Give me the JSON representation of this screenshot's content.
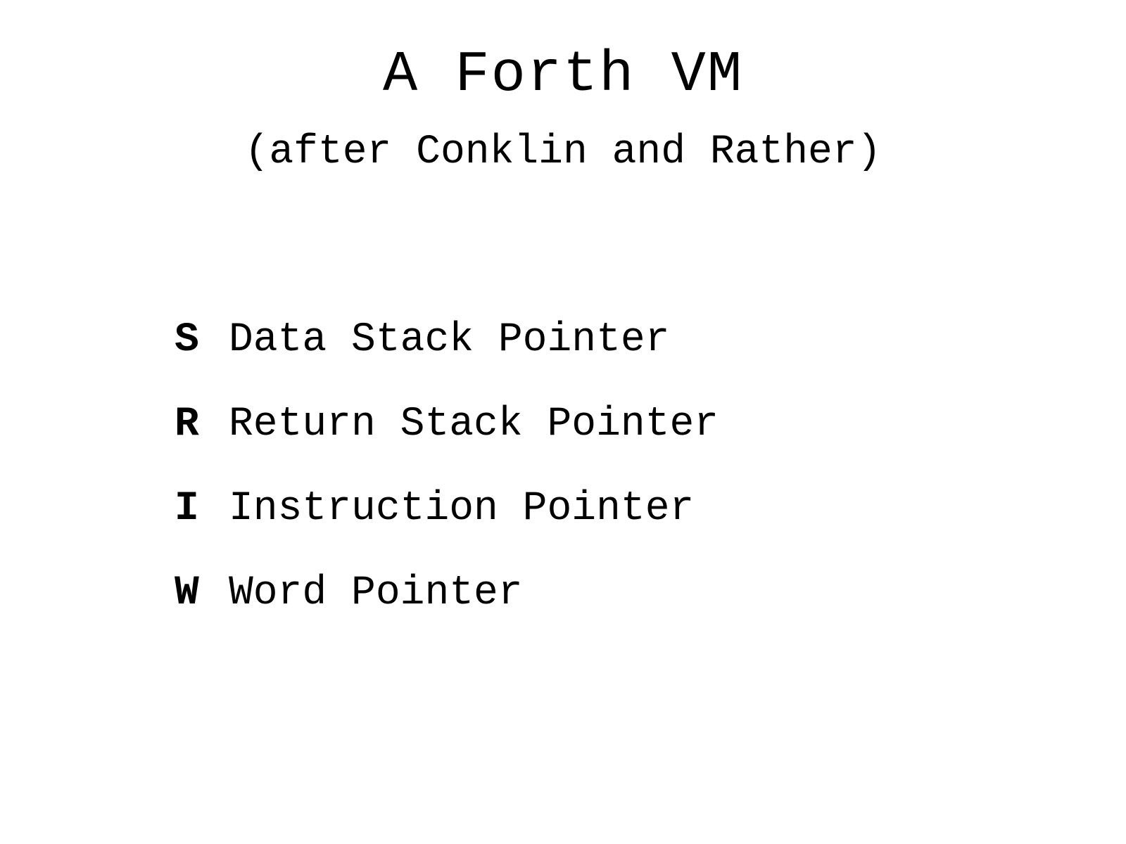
{
  "slide": {
    "title": "A Forth VM",
    "subtitle": "(after Conklin and Rather)",
    "registers": [
      {
        "letter": "S",
        "description": "Data Stack Pointer"
      },
      {
        "letter": "R",
        "description": "Return Stack Pointer"
      },
      {
        "letter": "I",
        "description": "Instruction Pointer"
      },
      {
        "letter": "W",
        "description": "Word Pointer"
      }
    ]
  }
}
